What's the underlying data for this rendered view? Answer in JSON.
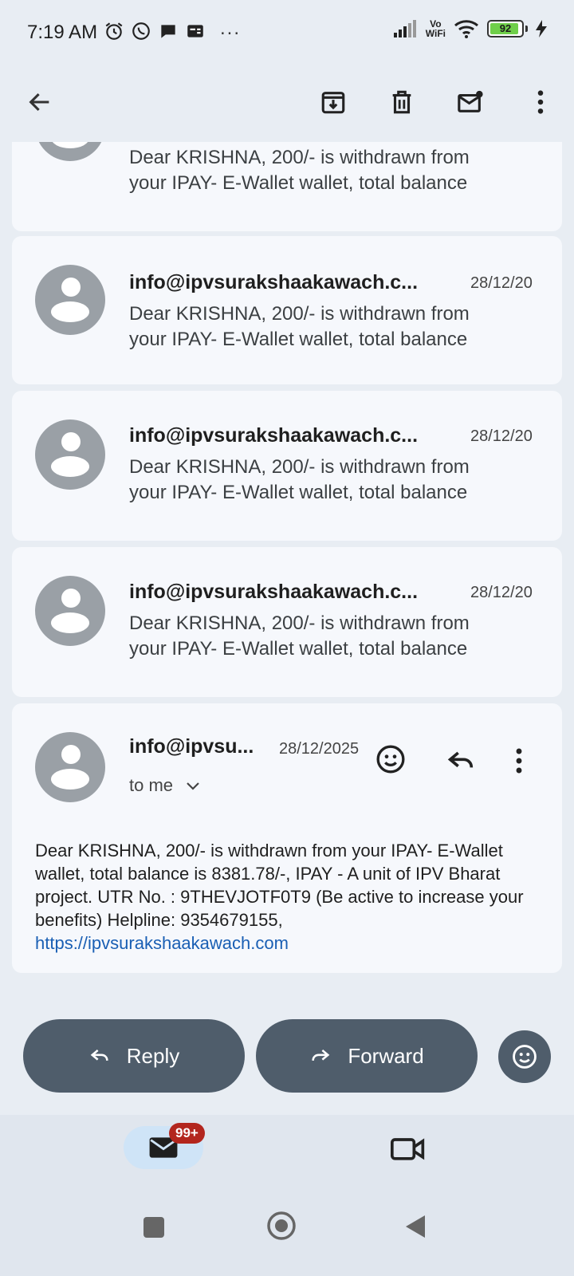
{
  "status_bar": {
    "time": "7:19 AM",
    "vowifi_top": "Vo",
    "vowifi_bottom": "WiFi",
    "battery": "92",
    "more": "..."
  },
  "emails": [
    {
      "snippet_line1": "Dear KRISHNA, 200/- is withdrawn from",
      "snippet_line2": "your IPAY- E-Wallet wallet, total balance"
    },
    {
      "sender": "info@ipvsurakshaakawach.c...",
      "date": "28/12/20",
      "snippet_line1": "Dear KRISHNA, 200/- is withdrawn from",
      "snippet_line2": "your IPAY- E-Wallet wallet, total balance"
    },
    {
      "sender": "info@ipvsurakshaakawach.c...",
      "date": "28/12/20",
      "snippet_line1": "Dear KRISHNA, 200/- is withdrawn from",
      "snippet_line2": "your IPAY- E-Wallet wallet, total balance"
    },
    {
      "sender": "info@ipvsurakshaakawach.c...",
      "date": "28/12/20",
      "snippet_line1": "Dear KRISHNA, 200/- is withdrawn from",
      "snippet_line2": "your IPAY- E-Wallet wallet, total balance"
    }
  ],
  "expanded": {
    "sender": "info@ipvsu...",
    "date": "28/12/2025",
    "recipient": "to me",
    "body": "Dear KRISHNA, 200/- is withdrawn from your IPAY- E-Wallet wallet, total balance is 8381.78/-, IPAY - A unit of IPV Bharat project. UTR No. : 9THEVJOTF0T9 (Be active to increase your benefits) Helpline: 9354679155, ",
    "link": "https://ipvsurakshaakawach.com"
  },
  "actions": {
    "reply_label": "Reply",
    "forward_label": "Forward"
  },
  "bottom_nav": {
    "mail_badge": "99+"
  }
}
